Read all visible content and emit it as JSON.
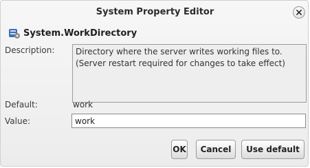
{
  "dialog": {
    "title": "System Property Editor",
    "close_icon": "close-icon"
  },
  "property": {
    "icon": "property-icon",
    "name": "System.WorkDirectory"
  },
  "fields": {
    "description_label": "Description:",
    "description_text": "Directory where the server writes working files to. (Server restart required for changes to take effect)",
    "default_label": "Default:",
    "default_value": "work",
    "value_label": "Value:",
    "value_current": "work"
  },
  "buttons": {
    "ok": "OK",
    "cancel": "Cancel",
    "use_default": "Use default"
  }
}
